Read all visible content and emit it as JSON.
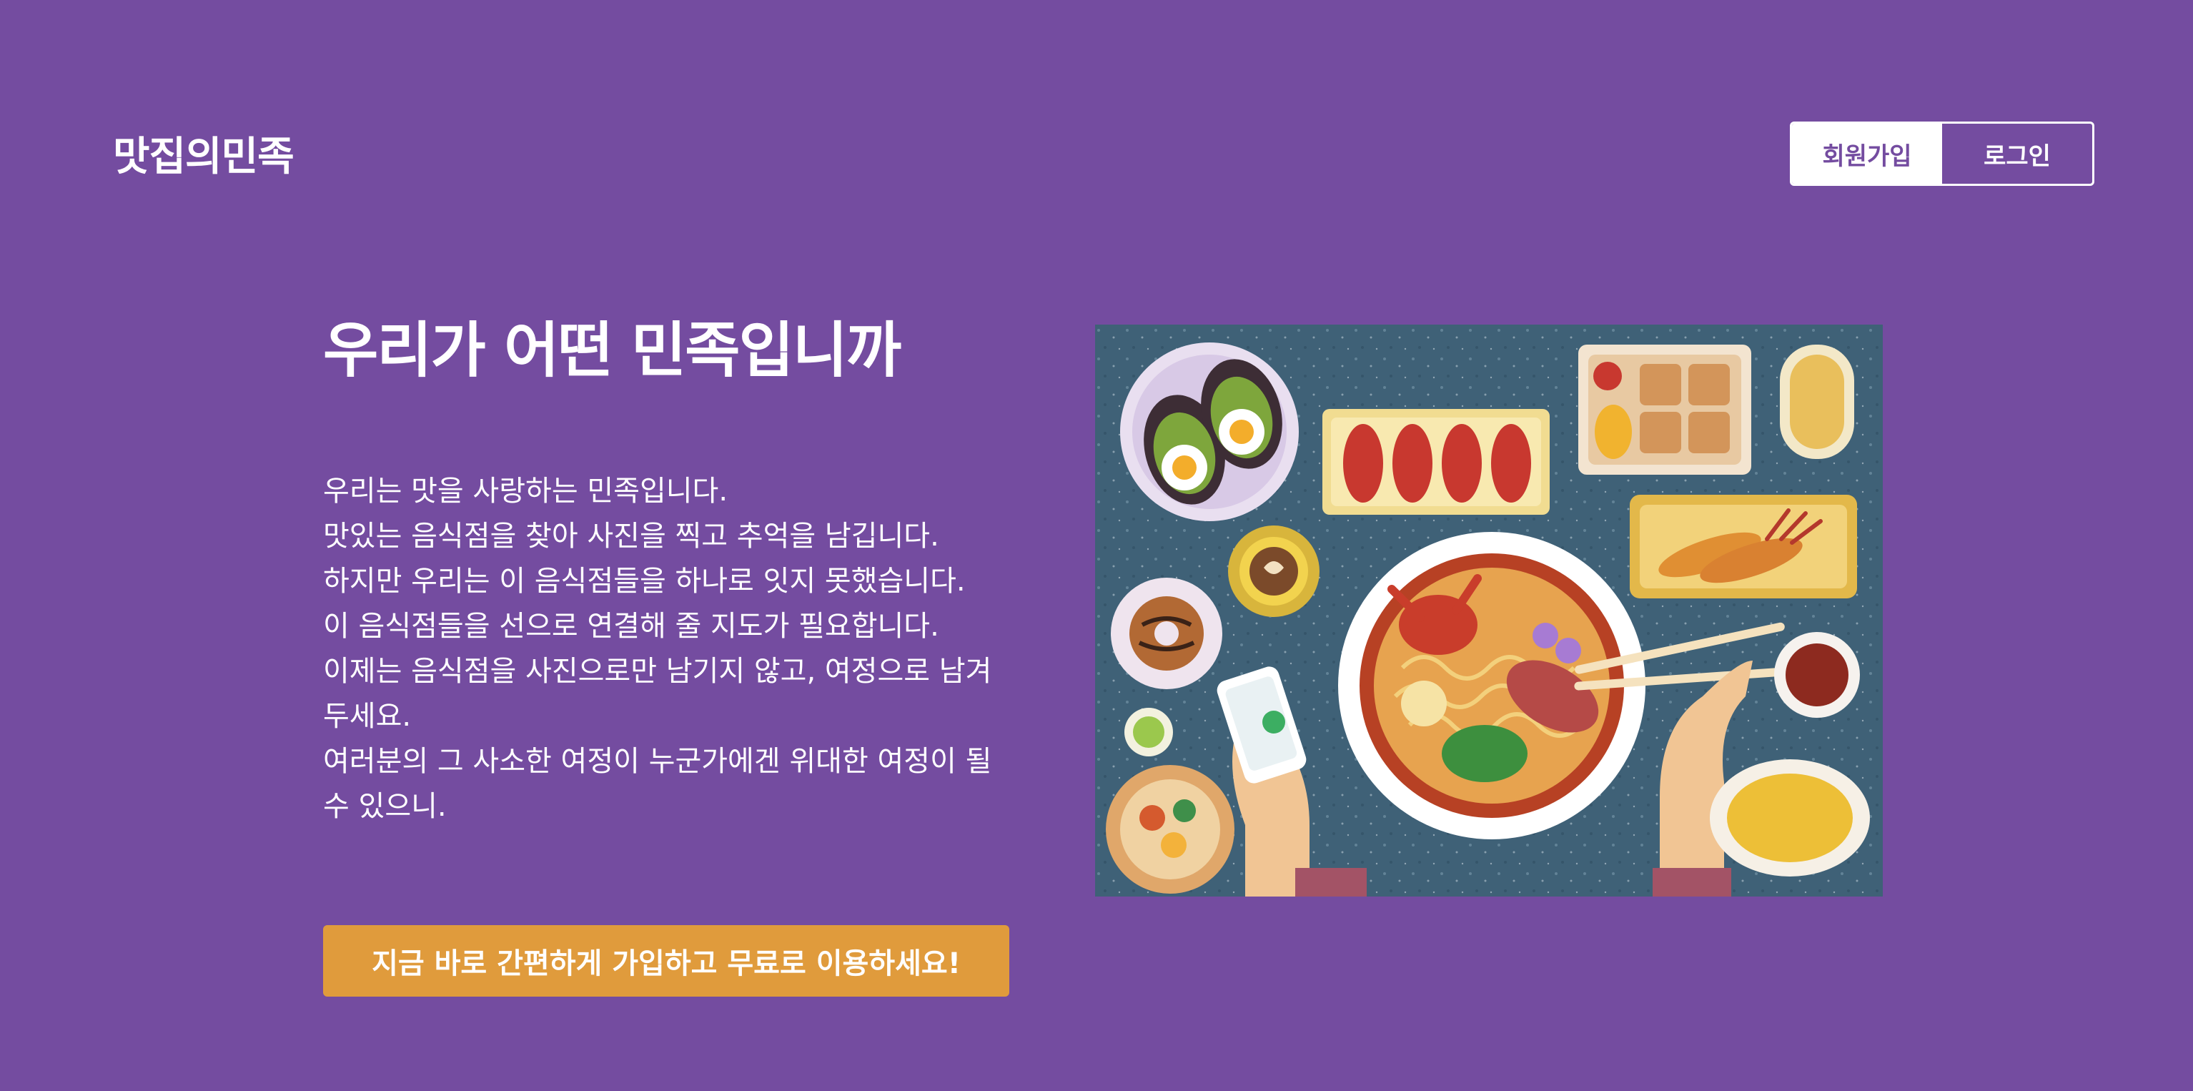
{
  "header": {
    "logo": "맛집의민족",
    "signup_label": "회원가입",
    "login_label": "로그인"
  },
  "hero": {
    "title": "우리가 어떤 민족입니까",
    "lines": [
      "우리는 맛을 사랑하는 민족입니다.",
      "맛있는 음식점을 찾아 사진을 찍고 추억을 남깁니다.",
      "하지만 우리는 이 음식점들을 하나로 잇지 못했습니다.",
      "이 음식점들을 선으로 연결해 줄 지도가 필요합니다.",
      "이제는 음식점을 사진으로만 남기지 않고, 여정으로 남겨두세요.",
      "여러분의 그 사소한 여정이 누군가에겐 위대한 여정이 될 수 있으니."
    ],
    "cta_label": "지금 바로 간편하게 가입하고 무료로 이용하세요!"
  },
  "colors": {
    "background": "#744ca0",
    "cta": "#e09b3c",
    "text": "#ffffff"
  }
}
